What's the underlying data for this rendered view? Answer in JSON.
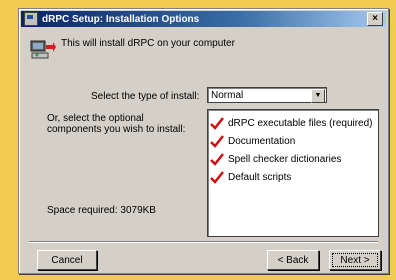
{
  "window": {
    "title": "dRPC Setup: Installation Options",
    "close_label": "×"
  },
  "intro_text": "This will install dRPC on your computer",
  "install_type": {
    "label": "Select the type of install:",
    "selected": "Normal"
  },
  "components": {
    "label": "Or, select the optional components you wish to install:",
    "items": [
      {
        "label": "dRPC executable files (required)",
        "checked": true
      },
      {
        "label": "Documentation",
        "checked": true
      },
      {
        "label": "Spell checker dictionaries",
        "checked": true
      },
      {
        "label": "Default scripts",
        "checked": true
      }
    ]
  },
  "space_required": "Space required: 3079KB",
  "buttons": {
    "cancel": "Cancel",
    "back": "< Back",
    "next": "Next >"
  },
  "colors": {
    "check": "#cc1010",
    "title_bar": "#0a246a"
  }
}
